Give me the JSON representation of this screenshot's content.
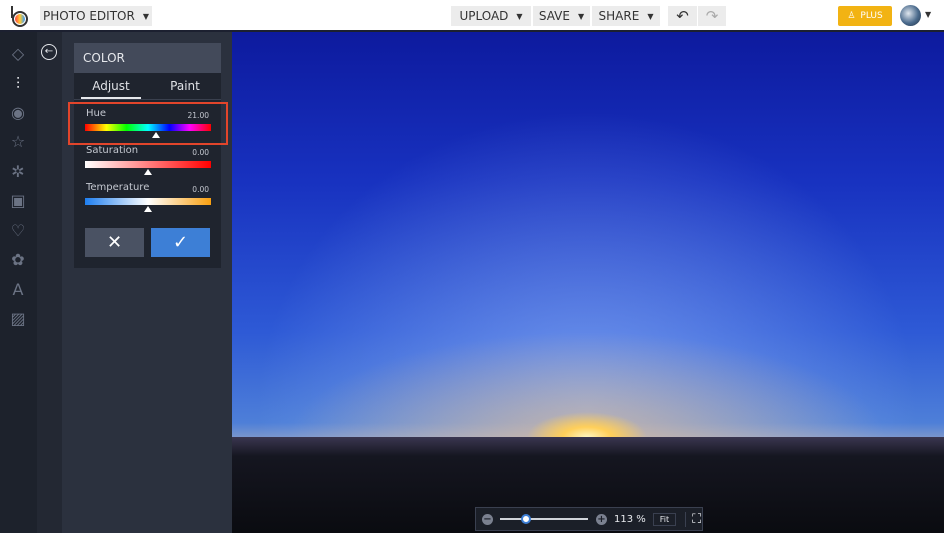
{
  "topbar": {
    "app_title": "PHOTO EDITOR",
    "upload": "UPLOAD",
    "save": "SAVE",
    "share": "SHARE",
    "plus": "PLUS"
  },
  "panel": {
    "title": "COLOR",
    "tabs": [
      {
        "label": "Adjust",
        "active": true
      },
      {
        "label": "Paint",
        "active": false
      }
    ],
    "sliders": [
      {
        "label": "Hue",
        "value": "21.00",
        "fraction": 0.56
      },
      {
        "label": "Saturation",
        "value": "0.00",
        "fraction": 0.5
      },
      {
        "label": "Temperature",
        "value": "0.00",
        "fraction": 0.5
      }
    ]
  },
  "zoom": {
    "level": "113 %",
    "fit": "Fit",
    "fraction": 0.3
  },
  "colors": {
    "accent": "#3d7fd6",
    "plus": "#f2b313",
    "highlight": "#e2452b"
  }
}
